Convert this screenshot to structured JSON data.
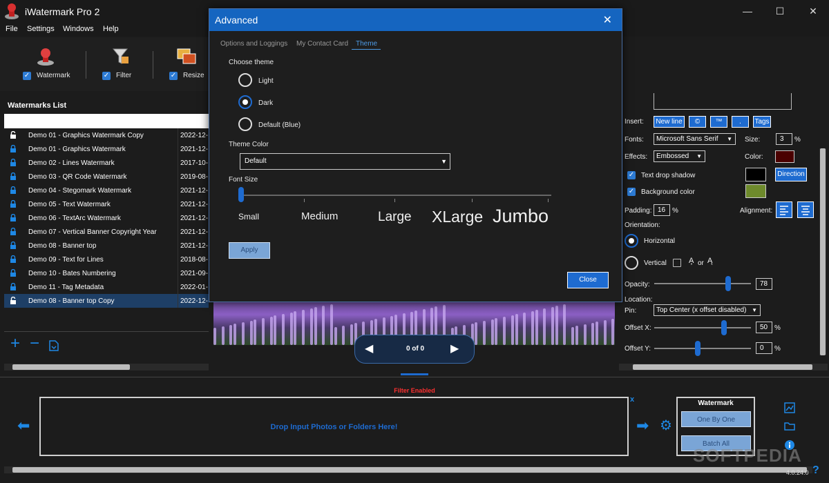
{
  "app": {
    "title": "iWatermark Pro 2"
  },
  "window_controls": {
    "minimize": "—",
    "maximize": "☐",
    "close": "✕"
  },
  "menu": [
    "File",
    "Settings",
    "Windows",
    "Help"
  ],
  "toolbar": {
    "watermark": "Watermark",
    "filter": "Filter",
    "resize": "Resize"
  },
  "watermarks_list": {
    "title": "Watermarks List",
    "rows": [
      {
        "name": "Demo 01 - Graphics Watermark Copy",
        "date": "2022-12-",
        "locked": false
      },
      {
        "name": "Demo 01 - Graphics Watermark",
        "date": "2021-12-",
        "locked": true
      },
      {
        "name": "Demo 02 - Lines Watermark",
        "date": "2017-10-",
        "locked": true
      },
      {
        "name": "Demo 03 - QR Code Watermark",
        "date": "2019-08-",
        "locked": true
      },
      {
        "name": "Demo 04 - Stegomark Watermark",
        "date": "2021-12-",
        "locked": true
      },
      {
        "name": "Demo 05 - Text Watermark",
        "date": "2021-12-",
        "locked": true
      },
      {
        "name": "Demo 06 - TextArc Watermark",
        "date": "2021-12-",
        "locked": true
      },
      {
        "name": "Demo 07 - Vertical Banner Copyright Year",
        "date": "2021-12-",
        "locked": true
      },
      {
        "name": "Demo 08 - Banner top",
        "date": "2021-12-",
        "locked": true
      },
      {
        "name": "Demo 09 - Text for Lines",
        "date": "2018-08-",
        "locked": true
      },
      {
        "name": "Demo 10 - Bates Numbering",
        "date": "2021-09-",
        "locked": true
      },
      {
        "name": "Demo 11 - Tag Metadata",
        "date": "2022-01-",
        "locked": true
      },
      {
        "name": "Demo 08 - Banner top Copy",
        "date": "2022-12-",
        "locked": false
      }
    ],
    "selected_index": 12
  },
  "dialog": {
    "title": "Advanced",
    "tabs": [
      "Options and Loggings",
      "My Contact Card",
      "Theme"
    ],
    "active_tab": "Theme",
    "choose_theme_label": "Choose theme",
    "themes": [
      "Light",
      "Dark",
      "Default (Blue)"
    ],
    "selected_theme": "Dark",
    "theme_color_label": "Theme Color",
    "theme_color_value": "Default",
    "font_size_label": "Font Size",
    "font_sizes": [
      "Small",
      "Medium",
      "Large",
      "XLarge",
      "Jumbo"
    ],
    "font_size_selected": "Small",
    "apply": "Apply",
    "close": "Close"
  },
  "preview": {
    "counter": "0 of 0"
  },
  "properties": {
    "insert_label": "Insert:",
    "insert_buttons": [
      "New line",
      "©",
      "™",
      ".",
      "Tags"
    ],
    "fonts_label": "Fonts:",
    "font_value": "Microsoft Sans Serif",
    "size_label": "Size:",
    "size_value": "3",
    "percent": "%",
    "effects_label": "Effects:",
    "effects_value": "Embossed",
    "color_label": "Color:",
    "text_color": "#4a0000",
    "drop_shadow_label": "Text drop shadow",
    "shadow_color": "#000000",
    "direction": "Direction",
    "bg_color_label": "Background color",
    "bg_color": "#6e8a2c",
    "padding_label": "Padding:",
    "padding_value": "16",
    "alignment_label": "Alignment:",
    "orientation_label": "Orientation:",
    "horizontal": "Horizontal",
    "vertical": "Vertical",
    "vertical_or": "or",
    "opacity_label": "Opacity:",
    "opacity_value": "78",
    "location_label": "Location:",
    "pin_label": "Pin:",
    "pin_value": "Top Center (x offset disabled)",
    "offset_x_label": "Offset X:",
    "offset_x_value": "50",
    "offset_y_label": "Offset Y:",
    "offset_y_value": "0"
  },
  "bottom": {
    "filter_status": "Filter Enabled",
    "drop_text": "Drop Input Photos or Folders Here!",
    "close_x": "x",
    "watermark_box_title": "Watermark",
    "one_by_one": "One By One",
    "batch_all": "Batch All",
    "version": "4.0.24.0",
    "softpedia": "SOFTPEDIA"
  },
  "colors": {
    "accent": "#1e6bd0",
    "dialog_title": "#1565c0",
    "filter_status": "#ff3030"
  }
}
